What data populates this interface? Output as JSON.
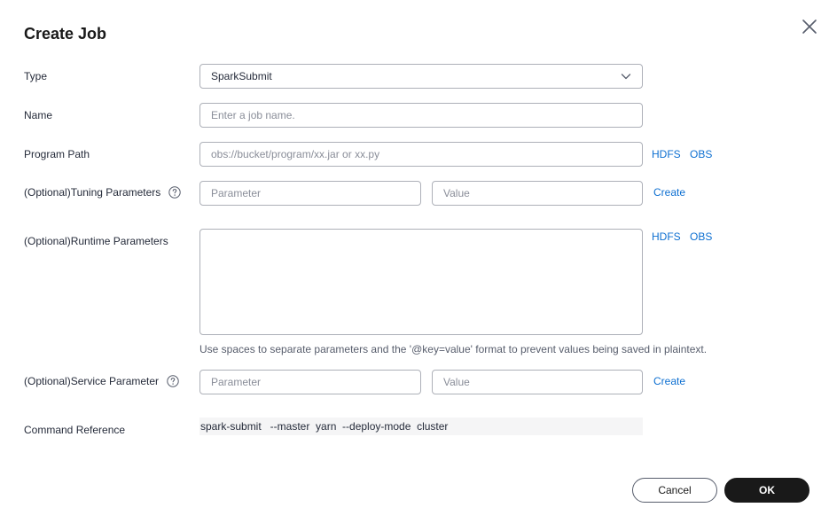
{
  "dialog": {
    "title": "Create Job",
    "close_icon": "close-icon"
  },
  "type": {
    "label": "Type",
    "value": "SparkSubmit",
    "icon": "chevron-down-icon"
  },
  "name": {
    "label": "Name",
    "placeholder": "Enter a job name."
  },
  "program_path": {
    "label": "Program Path",
    "placeholder": "obs://bucket/program/xx.jar or xx.py",
    "hdfs_link": "HDFS",
    "obs_link": "OBS"
  },
  "tuning": {
    "label": "(Optional)Tuning Parameters",
    "icon": "help-icon",
    "param_placeholder": "Parameter",
    "value_placeholder": "Value",
    "create_link": "Create"
  },
  "runtime": {
    "label": "(Optional)Runtime Parameters",
    "hdfs_link": "HDFS",
    "obs_link": "OBS",
    "hint": "Use spaces to separate parameters and the '@key=value' format to prevent values being saved in plaintext."
  },
  "service": {
    "label": "(Optional)Service Parameter",
    "icon": "help-icon",
    "param_placeholder": "Parameter",
    "value_placeholder": "Value",
    "create_link": "Create"
  },
  "command": {
    "label": "Command Reference",
    "value": "spark-submit   --master  yarn  --deploy-mode  cluster"
  },
  "footer": {
    "cancel_label": "Cancel",
    "ok_label": "OK"
  },
  "colors": {
    "link": "#0d6fd1",
    "primary_button": "#191919",
    "border": "#adb0b8",
    "placeholder": "#8a8e99"
  }
}
